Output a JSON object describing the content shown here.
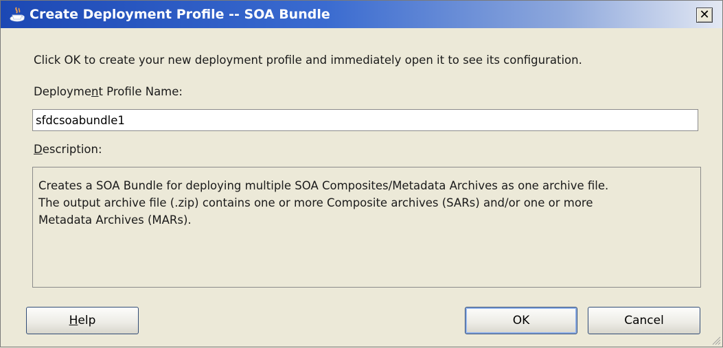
{
  "window": {
    "title": "Create Deployment Profile -- SOA Bundle",
    "close_glyph": "✕",
    "title_icon": "java-cup-icon",
    "colors": {
      "title_start": "#1c48b4",
      "title_end": "#e3e8f3",
      "background": "#ece9d8"
    }
  },
  "content": {
    "intro": "Click OK to create your new deployment profile and immediately open it to see its configuration.",
    "name_label": {
      "pre": "Deployme",
      "mnemonic": "n",
      "post": "t Profile Name:"
    },
    "name_value": "sfdcsoabundle1",
    "desc_label": {
      "mnemonic": "D",
      "post": "escription:"
    },
    "description_lines": [
      "Creates a SOA Bundle for deploying multiple SOA Composites/Metadata Archives as one archive file.",
      "The output archive file (.zip) contains one or more Composite archives (SARs) and/or one or more",
      "Metadata Archives (MARs)."
    ]
  },
  "buttons": {
    "help": {
      "mnemonic": "H",
      "post": "elp"
    },
    "ok": "OK",
    "cancel": "Cancel"
  }
}
